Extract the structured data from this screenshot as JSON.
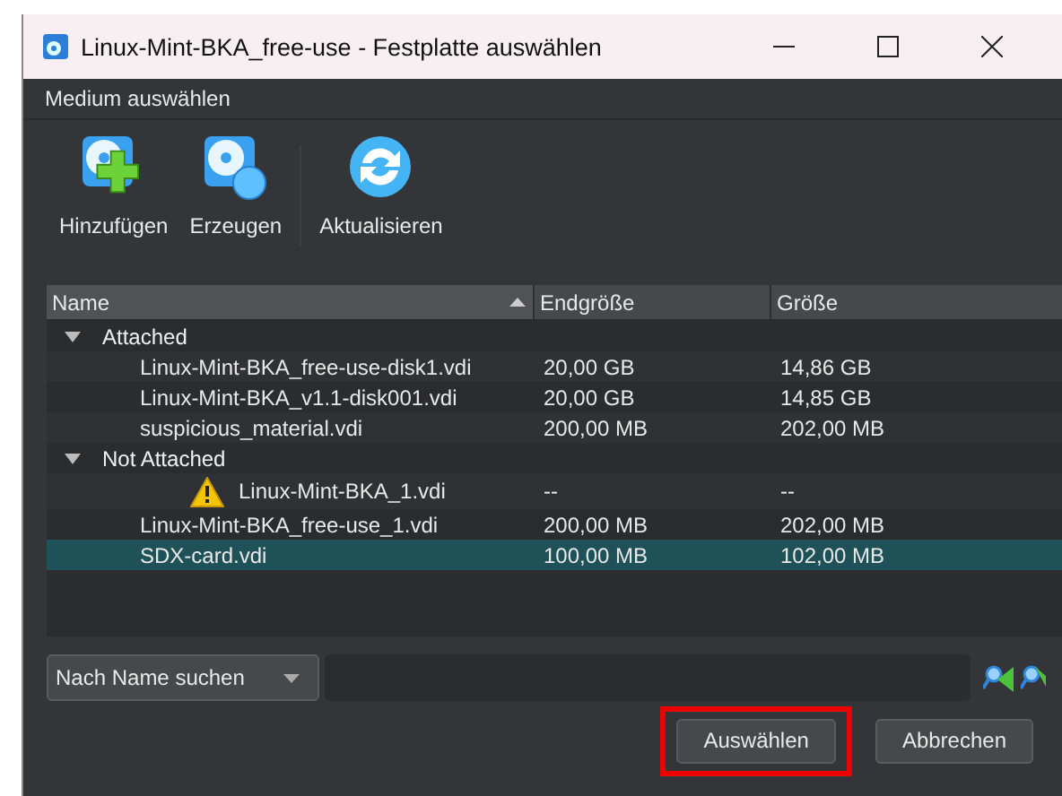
{
  "window": {
    "title": "Linux-Mint-BKA_free-use - Festplatte auswählen"
  },
  "menu": {
    "label": "Medium auswählen"
  },
  "toolbar": [
    {
      "label": "Hinzufügen",
      "kind": "add"
    },
    {
      "label": "Erzeugen",
      "kind": "create"
    },
    {
      "label": "Aktualisieren",
      "kind": "refresh"
    }
  ],
  "table": {
    "columns": [
      {
        "label": "Name",
        "sorted": true
      },
      {
        "label": "Endgröße",
        "sorted": false
      },
      {
        "label": "Größe",
        "sorted": false
      }
    ],
    "groups": [
      {
        "label": "Attached",
        "expanded": true,
        "children": [
          {
            "name": "Linux-Mint-BKA_free-use-disk1.vdi",
            "virtual_size": "20,00 GB",
            "actual_size": "14,86 GB",
            "warning": false,
            "selected": false
          },
          {
            "name": "Linux-Mint-BKA_v1.1-disk001.vdi",
            "virtual_size": "20,00 GB",
            "actual_size": "14,85 GB",
            "warning": false,
            "selected": false
          },
          {
            "name": "suspicious_material.vdi",
            "virtual_size": "200,00 MB",
            "actual_size": "202,00 MB",
            "warning": false,
            "selected": false
          }
        ]
      },
      {
        "label": "Not Attached",
        "expanded": true,
        "children": [
          {
            "name": "Linux-Mint-BKA_1.vdi",
            "virtual_size": "--",
            "actual_size": "--",
            "warning": true,
            "selected": false
          },
          {
            "name": "Linux-Mint-BKA_free-use_1.vdi",
            "virtual_size": "200,00 MB",
            "actual_size": "202,00 MB",
            "warning": false,
            "selected": false
          },
          {
            "name": "SDX-card.vdi",
            "virtual_size": "100,00 MB",
            "actual_size": "102,00 MB",
            "warning": false,
            "selected": true
          }
        ]
      }
    ]
  },
  "search": {
    "mode": "Nach Name suchen"
  },
  "buttons": [
    {
      "label": "Auswählen",
      "highlighted": true
    },
    {
      "label": "Abbrechen",
      "highlighted": false
    }
  ]
}
